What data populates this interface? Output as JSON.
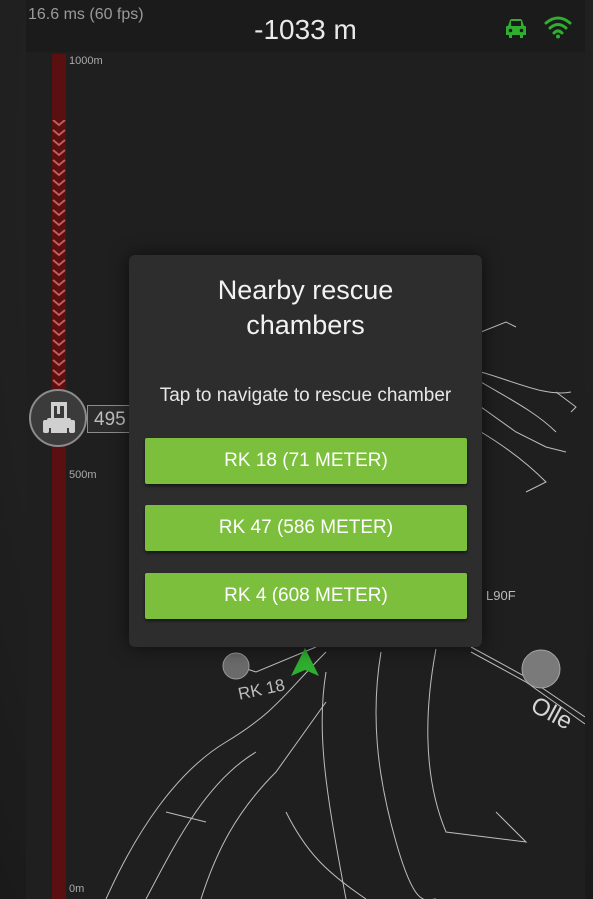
{
  "status": {
    "frame_time": "16.6 ms (60 fps)",
    "depth": "-1033 m"
  },
  "icons": {
    "vehicle_status": "car-icon",
    "connection": "wifi-icon",
    "vehicle_marker": "loader-vehicle-icon",
    "position_arrow": "navigation-arrow-icon"
  },
  "colors": {
    "accent_green": "#7cbf3c",
    "status_green": "#2fae2f",
    "depth_bar": "#5a1010"
  },
  "depth_scale": {
    "top": "1000m",
    "middle": "500m",
    "bottom": "0m"
  },
  "vehicle": {
    "distance": "495"
  },
  "map": {
    "rescue_chamber_label": "RK 18",
    "tunnel_label": "L90F",
    "road_label": "Olle"
  },
  "dialog": {
    "title": "Nearby rescue chambers",
    "subtitle": "Tap to navigate to rescue chamber",
    "options": [
      {
        "label": "RK 18 (71 METER)"
      },
      {
        "label": "RK 47 (586 METER)"
      },
      {
        "label": "RK 4 (608 METER)"
      }
    ]
  }
}
